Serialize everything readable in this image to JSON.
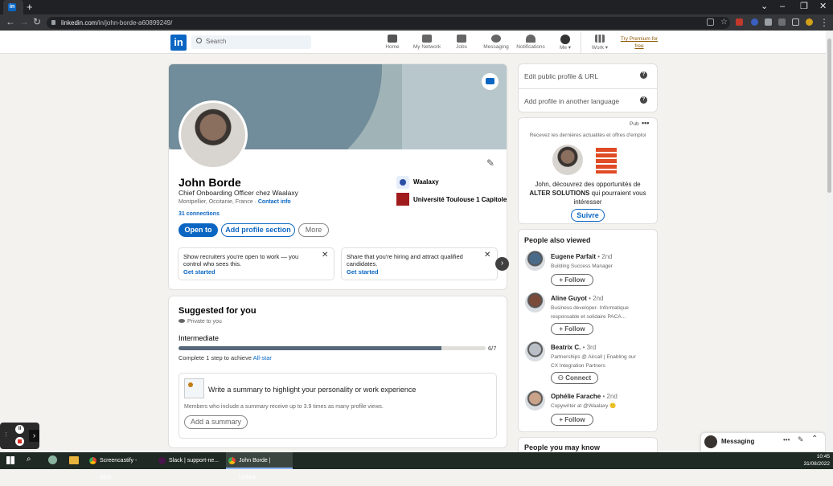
{
  "browser": {
    "tab_icon": "linkedin-icon",
    "url_host": "linkedin.com",
    "url_path": "/in/john-borde-a60899249/"
  },
  "nav": {
    "search_placeholder": "Search",
    "items": [
      {
        "label": "Home",
        "icon": "home-icon"
      },
      {
        "label": "My Network",
        "icon": "people-icon"
      },
      {
        "label": "Jobs",
        "icon": "briefcase-icon"
      },
      {
        "label": "Messaging",
        "icon": "chat-icon"
      },
      {
        "label": "Notifications",
        "icon": "bell-icon"
      },
      {
        "label": "Me",
        "icon": "avatar-icon"
      },
      {
        "label": "Work",
        "icon": "grid-icon"
      }
    ],
    "premium": "Try Premium for free"
  },
  "profile": {
    "name": "John Borde",
    "headline": "Chief Onboarding Officer chez Waalaxy",
    "location": "Montpellier, Occitanie, France",
    "contact": "Contact info",
    "connections": "31 connections",
    "btn_open": "Open to",
    "btn_add": "Add profile section",
    "btn_more": "More",
    "company": "Waalaxy",
    "school": "Université Toulouse 1 Capitole"
  },
  "promos": [
    {
      "text_bold": "Show recruiters you're open to work",
      "text_rest": " — you control who sees this.",
      "cta": "Get started"
    },
    {
      "text_bold": "Share that you're hiring",
      "text_rest": " and attract qualified candidates.",
      "cta": "Get started"
    }
  ],
  "suggested": {
    "title": "Suggested for you",
    "private": "Private to you",
    "level": "Intermediate",
    "progress": "6/7",
    "progress_fraction": 0.857,
    "step_text": "Complete 1 step to achieve",
    "step_link": "All-star",
    "summary_title": "Write a summary to highlight your personality or work experience",
    "summary_desc": "Members who include a summary receive up to 3.9 times as many profile views.",
    "summary_btn": "Add a summary"
  },
  "side": {
    "edit_url": "Edit public profile & URL",
    "add_lang": "Add profile in another language",
    "ad_label": "Pub",
    "ad_intro": "Recevez les dernières actualités et offres d'emploi",
    "ad_text_1": "John, découvrez des opportunités de",
    "ad_text_company": "ALTER SOLUTIONS",
    "ad_text_2": "qui pourraient vous intéresser",
    "ad_btn": "Suivre",
    "people_title": "People also viewed",
    "people": [
      {
        "name": "Eugene Parfait",
        "degree": " • 2nd",
        "sub": "Building Success Manager",
        "btn": "+ Follow",
        "color": "#4a6a8a"
      },
      {
        "name": "Aline Guyot",
        "degree": " • 2nd",
        "sub": "Business developer- Informatique responsable et solidaire PACA...",
        "btn": "+ Follow",
        "color": "#7a4a3a"
      },
      {
        "name": "Beatrix C.",
        "degree": " • 3rd",
        "sub": "Partnerships @ Aircall | Enabling our CX Integration Partners",
        "btn": "Connect",
        "color": "#b9bfc7"
      },
      {
        "name": "Ophélie Farache",
        "degree": " • 2nd",
        "sub": "Copywriter at @Waalaxy 🙂",
        "btn": "+ Follow",
        "color": "#c9a28a"
      }
    ],
    "may_know": "People you may know"
  },
  "messaging": {
    "label": "Messaging"
  },
  "taskbar": {
    "apps": [
      "Screencastify - Scre...",
      "Slack | support-ne...",
      "John Borde | Linked..."
    ],
    "time": "10:45",
    "date": "31/08/2022"
  },
  "colors": {
    "accent": "#0a66c2",
    "banner": "#a0b4b7"
  }
}
